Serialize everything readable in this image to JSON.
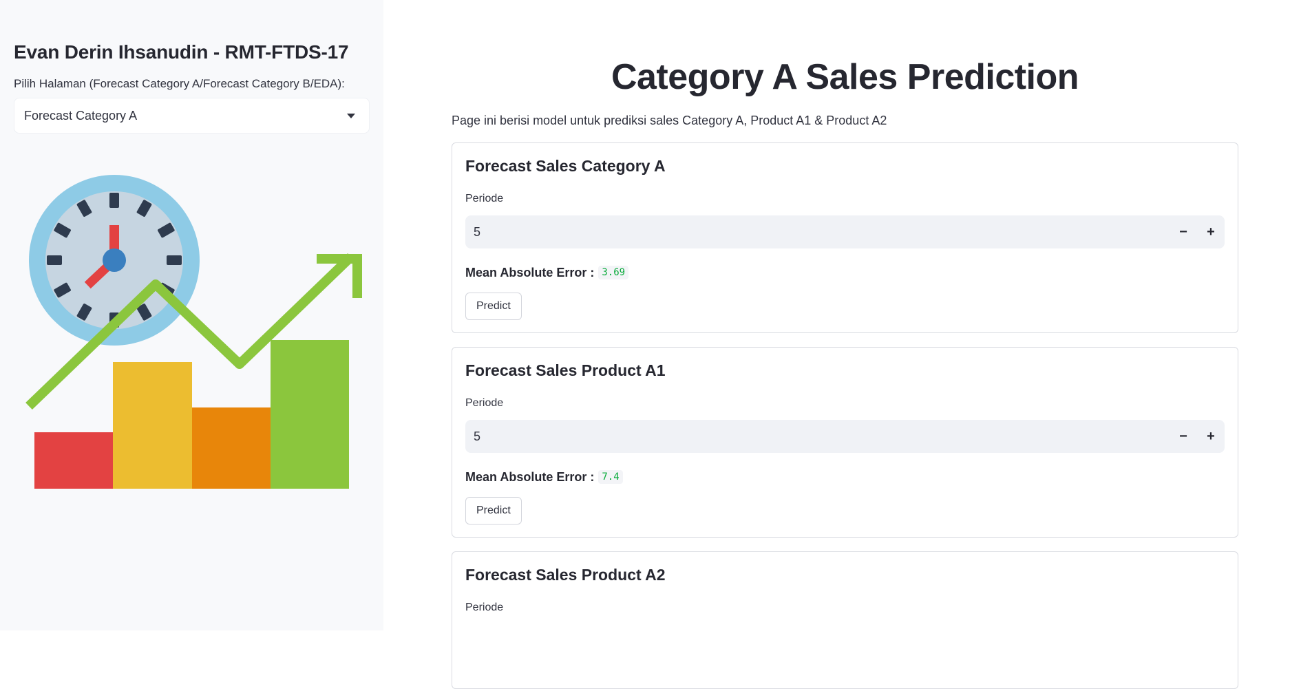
{
  "sidebar": {
    "title": "Evan Derin Ihsanudin - RMT-FTDS-17",
    "select_label": "Pilih Halaman (Forecast Category A/Forecast Category B/EDA):",
    "selected_option": "Forecast Category A",
    "illustration_icon": "sales-forecast-illustration"
  },
  "main": {
    "title": "Category A Sales Prediction",
    "description": "Page ini berisi model untuk prediksi sales Category A, Product A1 & Product A2",
    "forms": [
      {
        "title": "Forecast Sales Category A",
        "field_label": "Periode",
        "value": "5",
        "mae_label": "Mean Absolute Error :",
        "mae_value": "3.69",
        "button_label": "Predict"
      },
      {
        "title": "Forecast Sales Product A1",
        "field_label": "Periode",
        "value": "5",
        "mae_label": "Mean Absolute Error :",
        "mae_value": "7.4",
        "button_label": "Predict"
      },
      {
        "title": "Forecast Sales Product A2",
        "field_label": "Periode"
      }
    ]
  },
  "controls": {
    "minus": "−",
    "plus": "+"
  },
  "colors": {
    "sidebar_bg": "#f8f9fb",
    "mae_value": "#09ab3b",
    "clock_ring": "#8ecbe6",
    "clock_face": "#c6d5e1",
    "bar_red": "#e34242",
    "bar_yellow": "#ecbd30",
    "bar_orange": "#e8860a",
    "bar_green": "#8bc63d"
  }
}
